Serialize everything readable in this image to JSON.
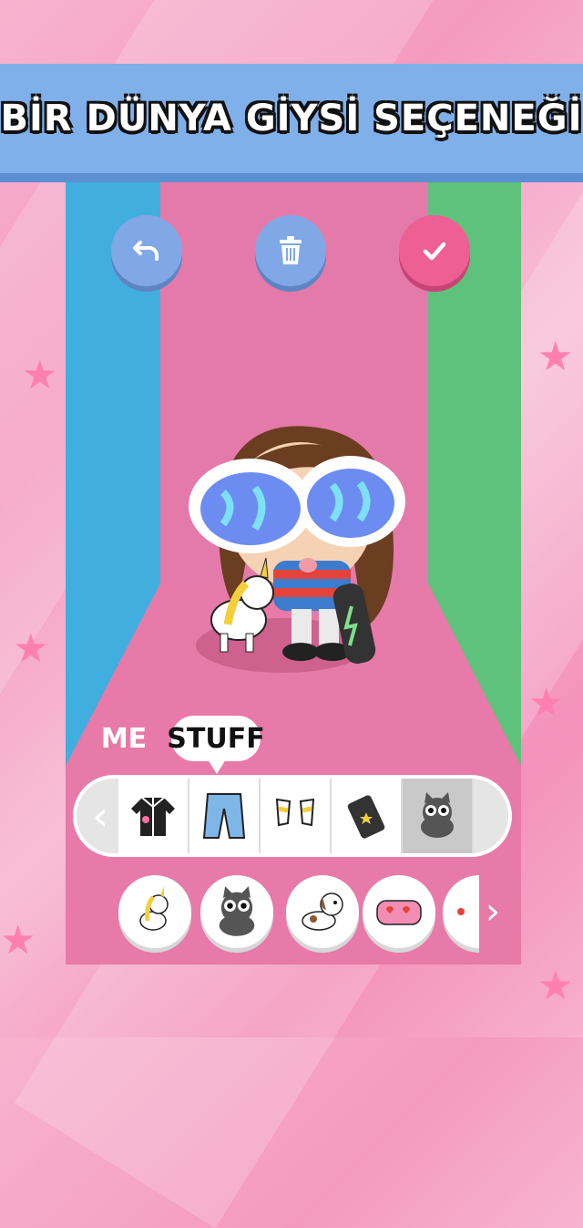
{
  "banner": {
    "title": "BİR DÜNYA GİYSİ SEÇENEĞİ"
  },
  "toolbar": {
    "undo_icon": "undo-icon",
    "trash_icon": "trash-icon",
    "confirm_icon": "check-icon"
  },
  "tabs": [
    {
      "label": "ME",
      "selected": false
    },
    {
      "label": "STUFF",
      "selected": true
    }
  ],
  "categories": [
    {
      "icon": "jacket-icon"
    },
    {
      "icon": "pants-icon"
    },
    {
      "icon": "sneakers-icon"
    },
    {
      "icon": "phone-icon"
    },
    {
      "icon": "cat-icon",
      "selected": true
    }
  ],
  "items": [
    {
      "icon": "unicorn-icon"
    },
    {
      "icon": "cat-icon"
    },
    {
      "icon": "dog-icon"
    },
    {
      "icon": "pencil-case-icon"
    },
    {
      "icon": "partial-item-icon"
    }
  ],
  "colors": {
    "accent_blue": "#80a8e6",
    "accent_pink": "#ee5f94",
    "wall_blue": "#41aee0",
    "wall_green": "#5ec27c",
    "wall_pink": "#e47aa9"
  }
}
